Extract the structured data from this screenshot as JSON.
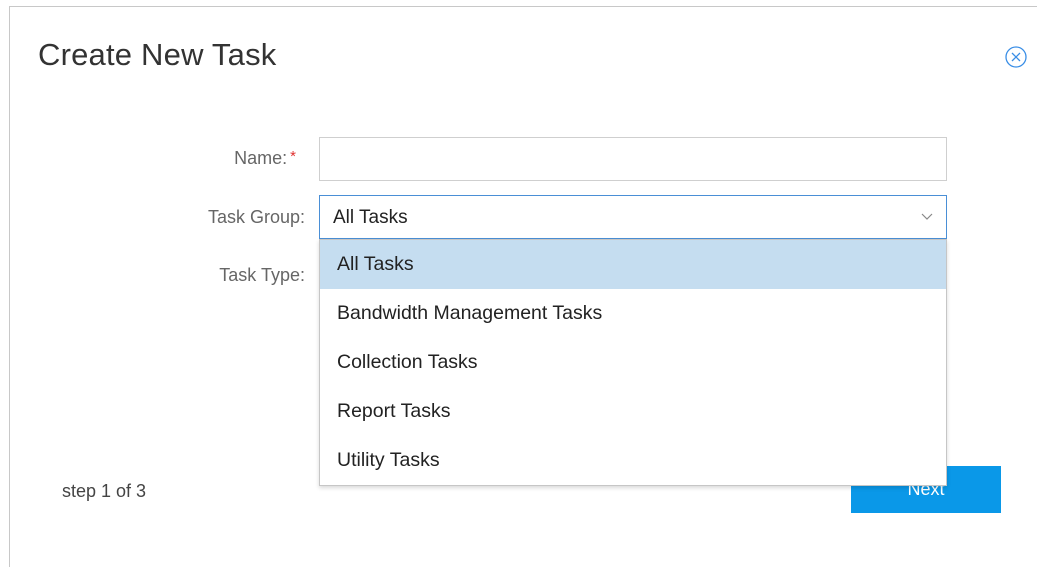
{
  "dialog": {
    "title": "Create New Task",
    "close_icon": "close-circle-icon"
  },
  "form": {
    "name_label": "Name:",
    "required_marker": "*",
    "name_value": "",
    "task_group_label": "Task Group:",
    "task_group_value": "All Tasks",
    "task_type_label": "Task Type:"
  },
  "dropdown": {
    "options": [
      "All Tasks",
      "Bandwidth Management Tasks",
      "Collection Tasks",
      "Report Tasks",
      "Utility Tasks"
    ],
    "selected_index": 0
  },
  "footer": {
    "step_text": "step 1 of 3",
    "next_label": "Next"
  },
  "colors": {
    "primary": "#0a98e8",
    "selected_option_bg": "#c5ddf0",
    "required": "#e0302f",
    "focus_border": "#4a8fd6"
  }
}
